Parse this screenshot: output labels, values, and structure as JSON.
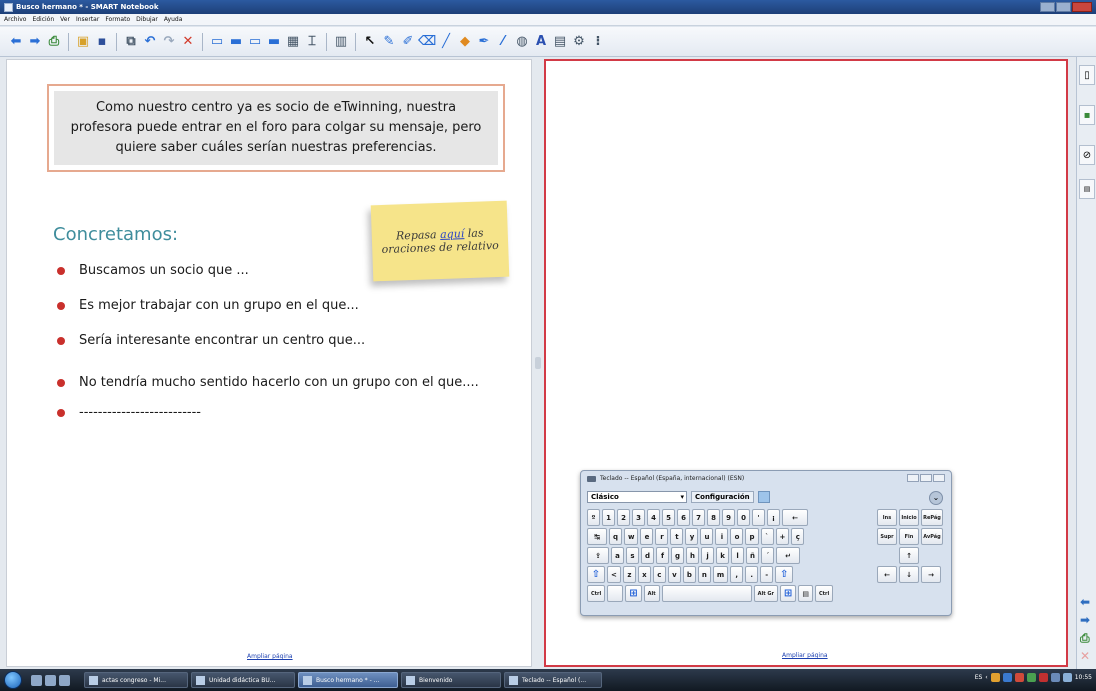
{
  "window": {
    "title": "Busco hermano * - SMART Notebook"
  },
  "menu": [
    "Archivo",
    "Edición",
    "Ver",
    "Insertar",
    "Formato",
    "Dibujar",
    "Ayuda"
  ],
  "toolbar": {
    "icons": [
      "back-arrow-icon",
      "forward-arrow-icon",
      "add-page-icon",
      "open-icon",
      "save-icon",
      "paste-icon",
      "undo-icon",
      "redo-icon",
      "delete-icon",
      "screen-shade-icon",
      "display-icon",
      "capture-icon",
      "document-camera-icon",
      "table-icon",
      "select-icon",
      "pen-icon",
      "creative-pen-icon",
      "eraser-icon",
      "line-icon",
      "shape-icon",
      "magic-pen-icon",
      "fill-icon",
      "text-icon",
      "properties-icon"
    ]
  },
  "left_page": {
    "intro_text": "Como nuestro centro ya es socio de eTwinning, nuestra profesora puede entrar en el foro para colgar su mensaje, pero quiere saber cuáles serían nuestras preferencias.",
    "heading": "Concretamos:",
    "bullets": [
      "Buscamos un socio que ...",
      "Es mejor trabajar con un grupo en el que...",
      "Sería interesante encontrar un centro que...",
      "No tendría mucho sentido hacerlo con un grupo con el que....",
      "--------------------------"
    ],
    "sticky": {
      "before": "Repasa ",
      "link": "aquí",
      "after": " las oraciones de relativo"
    },
    "footer_link": "Ampliar página"
  },
  "right_page": {
    "footer_link": "Ampliar página"
  },
  "keyboard": {
    "title": "Teclado -- Español (España, internacional) (ESN)",
    "layout_select": "Clásico",
    "config_label": "Configuración",
    "rows": [
      [
        "º",
        "1",
        "2",
        "3",
        "4",
        "5",
        "6",
        "7",
        "8",
        "9",
        "0",
        "'",
        "¡",
        "←"
      ],
      [
        "↹",
        "q",
        "w",
        "e",
        "r",
        "t",
        "y",
        "u",
        "i",
        "o",
        "p",
        "`",
        "+",
        "ç"
      ],
      [
        "⇪",
        "a",
        "s",
        "d",
        "f",
        "g",
        "h",
        "j",
        "k",
        "l",
        "ñ",
        "´",
        "↵"
      ],
      [
        "⇧",
        "<",
        "z",
        "x",
        "c",
        "v",
        "b",
        "n",
        "m",
        ",",
        ".",
        "-",
        "⇧"
      ],
      [
        "Ctrl",
        "",
        "⊞",
        "Alt",
        "",
        "Alt Gr",
        "⊞",
        "▤",
        "Ctrl"
      ]
    ],
    "side_rows": [
      [
        "Ins",
        "Inicio",
        "RePág"
      ],
      [
        "Supr",
        "Fin",
        "AvPág"
      ],
      [
        "",
        "↑",
        ""
      ],
      [
        "←",
        "↓",
        "→"
      ]
    ]
  },
  "taskbar": {
    "tasks": [
      {
        "label": "actas congreso - Mi...",
        "active": false
      },
      {
        "label": "Unidad didáctica BU...",
        "active": false
      },
      {
        "label": "Busco hermano * - ...",
        "active": true
      },
      {
        "label": "Bienvenido",
        "active": false
      },
      {
        "label": "Teclado -- Español (...",
        "active": false
      }
    ],
    "language": "ES",
    "clock": "10:55"
  },
  "colors": {
    "accent_red": "#d23a46",
    "heading_teal": "#3f8d9c",
    "bullet_red": "#c9302c",
    "sticky_yellow": "#f6e48a"
  }
}
